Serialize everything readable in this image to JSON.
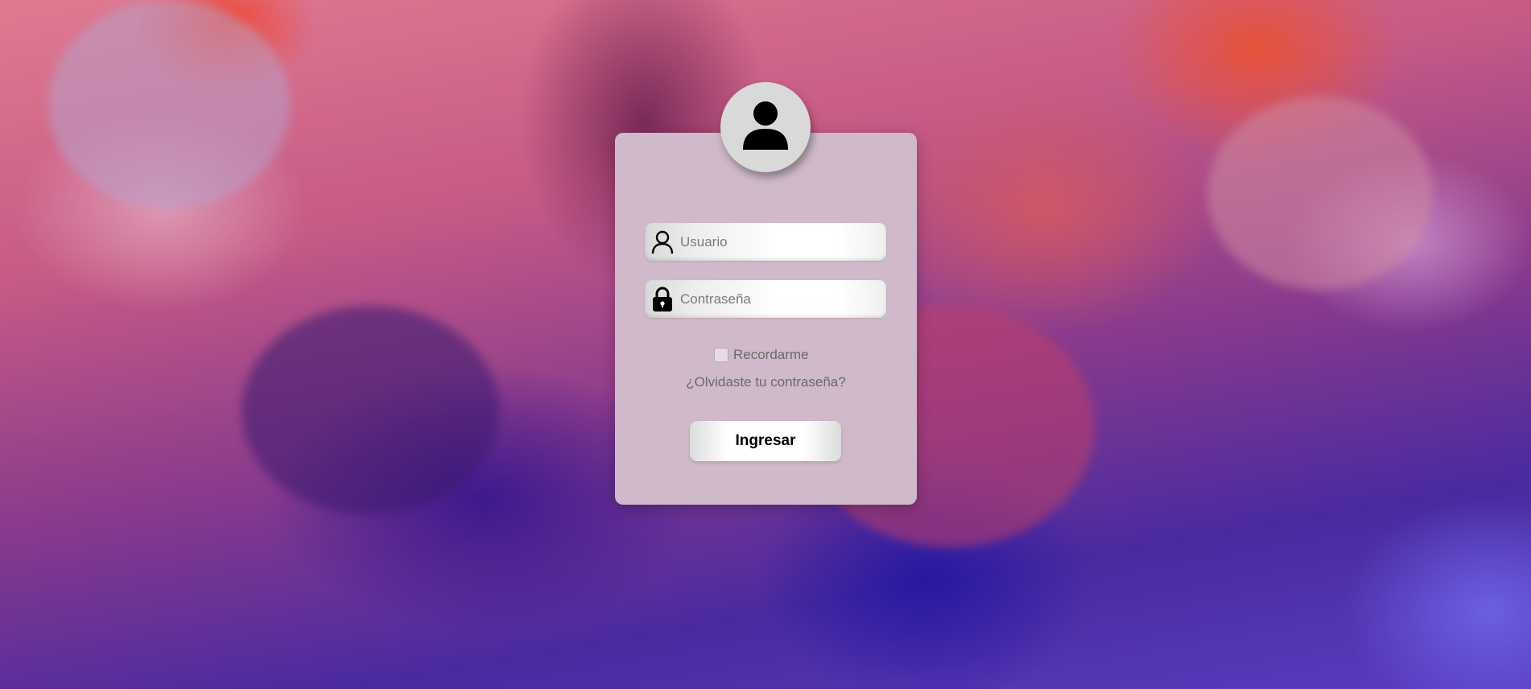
{
  "form": {
    "username": {
      "placeholder": "Usuario",
      "value": "",
      "icon": "user-outline-icon"
    },
    "password": {
      "placeholder": "Contraseña",
      "value": "",
      "icon": "lock-icon"
    },
    "remember_label": "Recordarme",
    "remember_checked": false,
    "forgot_label": "¿Olvidaste tu contraseña?",
    "submit_label": "Ingresar"
  },
  "avatar": {
    "icon": "user-avatar-icon"
  },
  "colors": {
    "card": "#cfb9ca",
    "avatar_bg": "#d9d9d9"
  }
}
